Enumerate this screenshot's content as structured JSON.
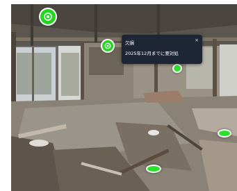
{
  "tooltip": {
    "title": "欠損",
    "body": "2025年12月までに要対処",
    "close_glyph": "×"
  },
  "icons": {
    "camera": "camera-icon",
    "close": "close-icon"
  },
  "colors": {
    "hotspot_green": "#22d622",
    "tooltip_bg": "#1e2636",
    "tooltip_text": "#ffffff"
  }
}
